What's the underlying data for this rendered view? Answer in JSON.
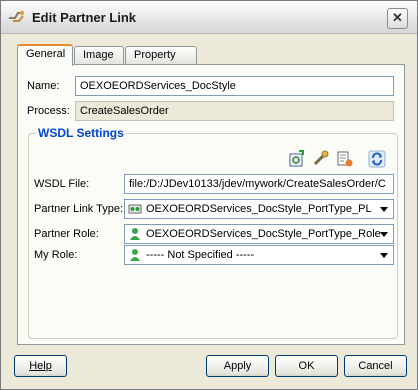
{
  "window": {
    "title": "Edit Partner Link",
    "close_glyph": "✕"
  },
  "tabs": [
    {
      "label": "General",
      "active": true
    },
    {
      "label": "Image",
      "active": false
    },
    {
      "label": "Property",
      "active": false
    }
  ],
  "general": {
    "name_label": "Name:",
    "name_value": "OEXOEORDServices_DocStyle",
    "process_label": "Process:",
    "process_value": "CreateSalesOrder"
  },
  "wsdl": {
    "group_title": "WSDL Settings",
    "toolbar_icons": [
      "define-service-icon",
      "browse-wsdl-icon",
      "browse-services-icon",
      "refresh-icon"
    ],
    "file_label": "WSDL File:",
    "file_value": "file:/D:/JDev10133/jdev/mywork/CreateSalesOrder/C",
    "link_type_label": "Partner Link Type:",
    "link_type_value": "OEXOEORDServices_DocStyle_PortType_PL",
    "partner_role_label": "Partner Role:",
    "partner_role_value": "OEXOEORDServices_DocStyle_PortType_Role",
    "my_role_label": "My Role:",
    "my_role_value": "----- Not Specified -----"
  },
  "buttons": {
    "help": "Help",
    "apply": "Apply",
    "ok": "OK",
    "cancel": "Cancel"
  },
  "colors": {
    "accent_tab": "#e68b2c",
    "group_title": "#0046d5",
    "field_border": "#7f9db9"
  }
}
